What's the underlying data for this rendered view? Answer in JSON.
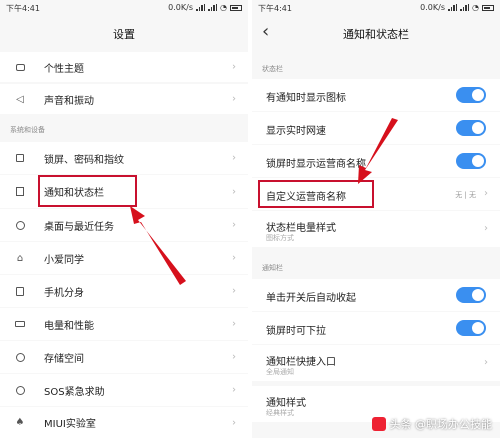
{
  "left": {
    "status_time": "下午4:41",
    "status_speed": "0.0K/s",
    "title": "设置",
    "items_top": [
      {
        "label": "个性主题",
        "icon": "theme-icon"
      },
      {
        "label": "声音和振动",
        "icon": "sound-icon"
      }
    ],
    "section_label": "系统和设备",
    "items_system": [
      {
        "label": "锁屏、密码和指纹",
        "icon": "lock-icon"
      },
      {
        "label": "通知和状态栏",
        "icon": "notification-icon"
      },
      {
        "label": "桌面与最近任务",
        "icon": "home-icon"
      },
      {
        "label": "小爱同学",
        "icon": "assistant-icon"
      },
      {
        "label": "手机分身",
        "icon": "clone-icon"
      },
      {
        "label": "电量和性能",
        "icon": "battery-icon"
      },
      {
        "label": "存储空间",
        "icon": "storage-icon"
      },
      {
        "label": "SOS紧急求助",
        "icon": "sos-icon"
      },
      {
        "label": "MIUI实验室",
        "icon": "lab-icon"
      }
    ]
  },
  "right": {
    "status_time": "下午4:41",
    "status_speed": "0.0K/s",
    "title": "通知和状态栏",
    "section1_label": "状态栏",
    "rows1": [
      {
        "label": "有通知时显示图标",
        "toggle": true
      },
      {
        "label": "显示实时网速",
        "toggle": true
      },
      {
        "label": "锁屏时显示运营商名称",
        "toggle": true
      },
      {
        "label": "自定义运营商名称",
        "value": "无 | 无"
      },
      {
        "label": "状态栏电量样式",
        "sub": "图标方式"
      }
    ],
    "section2_label": "通知栏",
    "rows2": [
      {
        "label": "单击开关后自动收起",
        "toggle": true
      },
      {
        "label": "锁屏时可下拉",
        "toggle": true
      },
      {
        "label": "通知栏快捷入口",
        "sub": "全局通知"
      },
      {
        "label": "通知样式",
        "sub": "经典样式"
      }
    ]
  },
  "watermark": "头条 @职场办公技能",
  "colors": {
    "accent": "#3a8ff0",
    "highlight": "#c8102e"
  }
}
